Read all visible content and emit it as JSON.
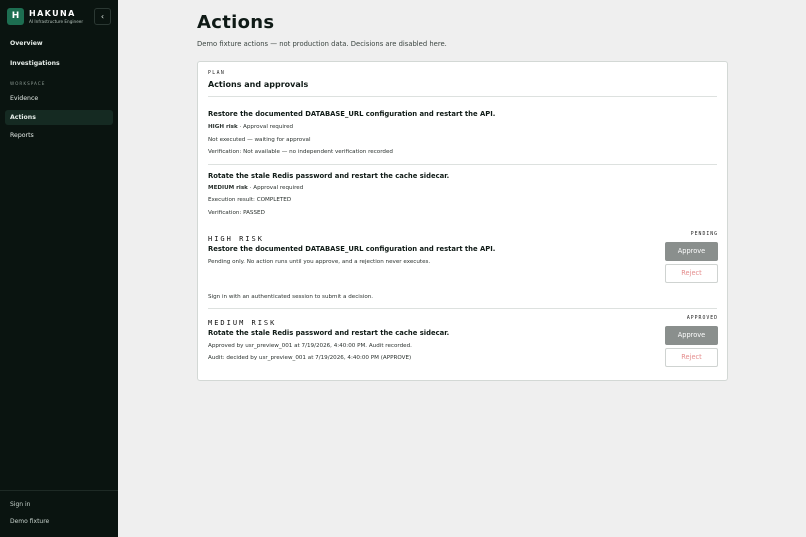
{
  "brand": {
    "logo_letter": "H",
    "name": "HAKUNA",
    "subtitle": "AI Infrastructure Engineer",
    "collapse_glyph": "‹"
  },
  "sidebar": {
    "items": [
      {
        "label": "Overview"
      },
      {
        "label": "Investigations"
      }
    ],
    "section_label": "WORKSPACE",
    "workspace_items": [
      {
        "label": "Evidence"
      },
      {
        "label": "Actions"
      },
      {
        "label": "Reports"
      }
    ],
    "footer": {
      "sign_in": "Sign in",
      "demo": "Demo fixture"
    }
  },
  "header": {
    "title": "Actions",
    "subtitle": "Demo fixture actions — not production data. Decisions are disabled here."
  },
  "plan": {
    "eyebrow": "PLAN",
    "title": "Actions and approvals",
    "items": [
      {
        "title": "Restore the documented DATABASE_URL configuration and restart the API.",
        "risk": "HIGH risk",
        "risk_suffix": " · Approval required",
        "line2": "Not executed — waiting for approval",
        "line3": "Verification: Not available — no independent verification recorded"
      },
      {
        "title": "Rotate the stale Redis password and restart the cache sidecar.",
        "risk": "MEDIUM risk",
        "risk_suffix": " · Approval required",
        "line2": "Execution result: COMPLETED",
        "line3": "Verification: PASSED"
      }
    ]
  },
  "approvals": [
    {
      "risk_label": "HIGH RISK",
      "status": "PENDING",
      "title": "Restore the documented DATABASE_URL configuration and restart the API.",
      "line1": "Pending only. No action runs until you approve, and a rejection never executes.",
      "note": "Sign in with an authenticated session to submit a decision.",
      "approve_label": "Approve",
      "reject_label": "Reject"
    },
    {
      "risk_label": "MEDIUM RISK",
      "status": "APPROVED",
      "title": "Rotate the stale Redis password and restart the cache sidecar.",
      "line1": "Approved by usr_preview_001 at 7/19/2026, 4:40:00 PM. Audit recorded.",
      "line2": "Audit: decided by usr_preview_001 at 7/19/2026, 4:40:00 PM (APPROVE)",
      "approve_label": "Approve",
      "reject_label": "Reject"
    }
  ],
  "colors": {
    "sidebar_bg": "#0a1410",
    "accent": "#1d6e51",
    "reject_text": "#e48c8c",
    "approve_bg": "#8a8f8d"
  }
}
